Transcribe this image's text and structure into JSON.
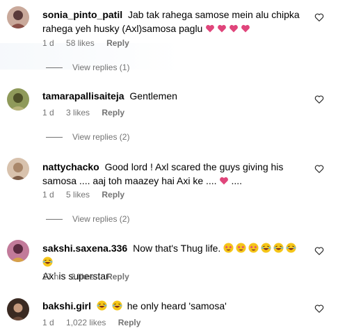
{
  "comments": [
    {
      "username": "sonia_pinto_patil",
      "text": "Jab tak rahega samose mein alu chipka rahega yeh husky (Axl)samosa paglu",
      "emojis": [
        "heart-emoji",
        "heart-emoji",
        "heart-emoji",
        "heart-emoji"
      ],
      "time": "1 d",
      "likes": "58 likes",
      "reply": "Reply",
      "view_replies": "View replies (1)",
      "avatar_color": "#5a3a3a"
    },
    {
      "username": "tamarapallisaiteja",
      "text": "Gentlemen",
      "time": "1 d",
      "likes": "3 likes",
      "reply": "Reply",
      "view_replies": "View replies (2)",
      "avatar_color": "#6b6f3a"
    },
    {
      "username": "nattychacko",
      "text": "Good lord ! Axl scared the guys giving his samosa .... aaj toh maazey hai Axi ke ....",
      "text_after": "....",
      "time": "1 d",
      "likes": "5 likes",
      "reply": "Reply",
      "view_replies": "View replies (2)",
      "avatar_color": "#b08d72"
    },
    {
      "username": "sakshi.saxena.336",
      "text": "Now that's Thug life.",
      "text_line2": "Axl is superstar",
      "time": "17 h",
      "likes": "3 likes",
      "reply": "Reply",
      "avatar_color": "#7d3a5a"
    },
    {
      "username": "bakshi.girl",
      "text": "he only heard 'samosa'",
      "time": "1 d",
      "likes": "1,022 likes",
      "reply": "Reply",
      "avatar_color": "#4a3228"
    }
  ],
  "colors": {
    "meta": "#737373",
    "heart_emoji": "#e0457b",
    "laugh_emoji": "#f5c518"
  }
}
